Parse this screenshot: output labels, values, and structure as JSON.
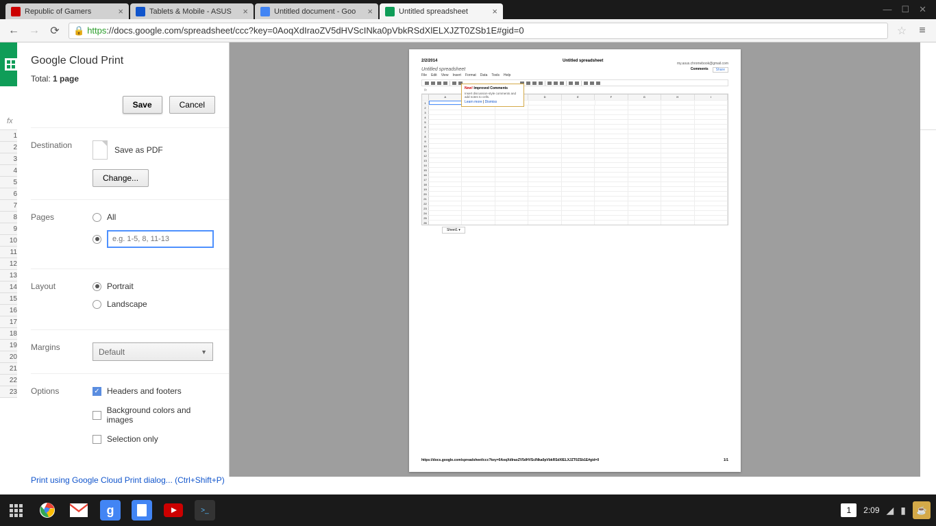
{
  "tabs": [
    {
      "title": "Republic of Gamers",
      "favicon": "rog"
    },
    {
      "title": "Tablets & Mobile - ASUS",
      "favicon": "asus"
    },
    {
      "title": "Untitled document - Goo",
      "favicon": "docs"
    },
    {
      "title": "Untitled spreadsheet",
      "favicon": "sheets",
      "active": true
    }
  ],
  "url": {
    "https": "https",
    "rest": "://docs.google.com/spreadsheet/ccc?key=0AoqXdIraoZV5dHVScINka0pVbkRSdXlELXJZT0ZSb1E#gid=0"
  },
  "fx_label": "fx",
  "row_numbers": [
    "1",
    "2",
    "3",
    "4",
    "5",
    "6",
    "7",
    "8",
    "9",
    "10",
    "11",
    "12",
    "13",
    "14",
    "15",
    "16",
    "17",
    "18",
    "19",
    "20",
    "21",
    "22",
    "23"
  ],
  "sheet_tab": "Sheet1",
  "print": {
    "title": "Google Cloud Print",
    "total_prefix": "Total: ",
    "total_value": "1 page",
    "save_btn": "Save",
    "cancel_btn": "Cancel",
    "destination_label": "Destination",
    "save_as_pdf": "Save as PDF",
    "change_btn": "Change...",
    "pages_label": "Pages",
    "all_label": "All",
    "pages_placeholder": "e.g. 1-5, 8, 11-13",
    "layout_label": "Layout",
    "portrait": "Portrait",
    "landscape": "Landscape",
    "margins_label": "Margins",
    "margins_value": "Default",
    "options_label": "Options",
    "headers_footers": "Headers and footers",
    "bg_colors": "Background colors and images",
    "selection_only": "Selection only",
    "cloud_link": "Print using Google Cloud Print dialog... (Ctrl+Shift+P)"
  },
  "preview": {
    "date": "2/2/2014",
    "title_center": "Untitled spreadsheet",
    "doc_title": "Untitled spreadsheet",
    "email": "my.asus.chromebook@gmail.com",
    "comments": "Comments",
    "share": "Share",
    "menu": [
      "File",
      "Edit",
      "View",
      "Insert",
      "Format",
      "Data",
      "Tools",
      "Help"
    ],
    "popup_new": "New!",
    "popup_title": "Improved Comments",
    "popup_desc": "Insert discussion-style comments and add notes to cells.",
    "popup_learn": "Learn more",
    "popup_dismiss": "Dismiss",
    "cols": [
      "A",
      "B",
      "C",
      "D",
      "E",
      "F",
      "G",
      "H",
      "I"
    ],
    "row_count": 26,
    "sheet_tab": "Sheet1",
    "footer_url": "https://docs.google.com/spreadsheet/ccc?key=0AoqXdIraoZV5dHVScINka0pVbkRSdXlELXJZT0ZSb1E#gid=0",
    "footer_page": "1/1",
    "fx": "fx"
  },
  "taskbar": {
    "notif": "1",
    "time": "2:09"
  }
}
